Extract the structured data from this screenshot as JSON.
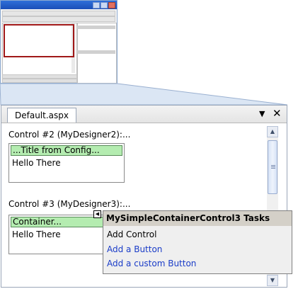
{
  "window": {
    "tab_label": "Default.aspx",
    "pin_glyph": "▼",
    "close_glyph": "✕"
  },
  "controls": [
    {
      "label": "Control #2 (MyDesigner2):...",
      "title": "...Title from Config...",
      "body": "Hello There"
    },
    {
      "label": "Control #3 (MyDesigner3):...",
      "title": "Container...",
      "body": "Hello There"
    }
  ],
  "tasks_panel": {
    "title": "MySimpleContainerControl3 Tasks",
    "items": [
      "Add Control",
      "Add a Button",
      "Add a custom Button"
    ]
  },
  "scrollbar": {
    "up_glyph": "▲",
    "down_glyph": "▼"
  },
  "smart_tag_glyph": "◀",
  "colors": {
    "highlight_green": "#b4ecb0",
    "link_blue": "#1a3cc8",
    "selection_red": "#a01818"
  }
}
